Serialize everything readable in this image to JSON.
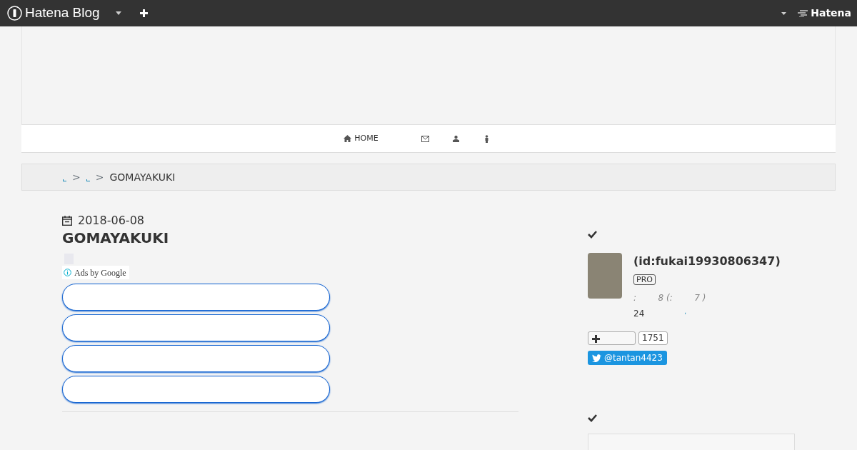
{
  "topbar": {
    "logo": "Hatena Blog",
    "brand": "Hatena"
  },
  "nav": {
    "items": [
      {
        "kind": "home",
        "label": "HOME"
      },
      {
        "kind": "mail"
      },
      {
        "kind": "people"
      },
      {
        "kind": "person"
      }
    ]
  },
  "breadcrumb": {
    "items": [
      {
        "kind": "link"
      },
      {
        "kind": "separator",
        "text": ">"
      },
      {
        "kind": "link"
      },
      {
        "kind": "separator",
        "text": ">"
      },
      {
        "kind": "current",
        "text": "GOMAYAKUKI"
      }
    ]
  },
  "entry": {
    "date": "2018-06-08",
    "title": "GOMAYAKUKI",
    "ads_label": "Ads by Google",
    "ad_buttons": [
      {
        "kind": "pill"
      },
      {
        "kind": "pill"
      },
      {
        "kind": "pill"
      },
      {
        "kind": "pill"
      }
    ]
  },
  "profile": {
    "name": "(id:fukai19930806347)",
    "badge": "PRO",
    "stats": ":        8 (:        7 )",
    "count_line": "24",
    "count_link": ",",
    "follow_count": "1751",
    "twitter": "@tantan4423"
  }
}
